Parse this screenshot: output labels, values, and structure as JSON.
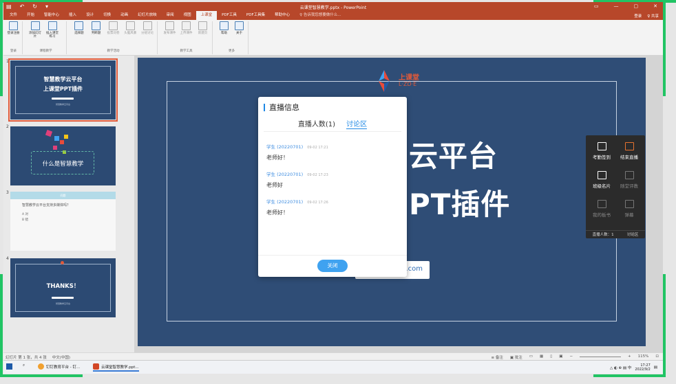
{
  "titlebar": {
    "doc_title": "云课堂智慧教学.pptx - PowerPoint",
    "qat": [
      "▤",
      "↶",
      "↻",
      "▾"
    ],
    "win_controls": [
      "▭",
      "—",
      "▢",
      "✕"
    ]
  },
  "menubar": {
    "tabs": [
      "文件",
      "开始",
      "智能中心",
      "插入",
      "设计",
      "切换",
      "动画",
      "幻灯片放映",
      "审阅",
      "视图",
      "上课堂",
      "PDF工具",
      "PDF工具集",
      "帮助中心"
    ],
    "active_tab": "上课堂",
    "search_hint": "♀ 告诉我您想要做什么...",
    "account": [
      "登录",
      "♀ 共享"
    ]
  },
  "ribbon": {
    "groups": [
      {
        "label": "登录",
        "buttons": [
          "登录注册"
        ]
      },
      {
        "label": "课程教学",
        "buttons": [
          "添加幻灯片",
          "插入课堂练习"
        ]
      },
      {
        "label": "教学活动",
        "buttons": [
          "选择题",
          "判断题",
          "投票问卷",
          "头脑风暴",
          "分组讨论"
        ]
      },
      {
        "label": "教学工具",
        "buttons": [
          "发布课件",
          "上传课件",
          "新建页"
        ]
      },
      {
        "label": "更多",
        "buttons": [
          "帮助",
          "关于"
        ]
      }
    ]
  },
  "thumbnails": [
    {
      "num": "1",
      "line1": "智慧教学云平台",
      "line2": "上课堂PPT插件",
      "caption": "智慧教学云平台"
    },
    {
      "num": "2",
      "line1": "什么是智慧教学"
    },
    {
      "num": "3",
      "header": "问题",
      "question": "智慧教学云平台支持多媒体吗？",
      "opt_a": "A  对",
      "opt_b": "B  错"
    },
    {
      "num": "4",
      "line1": "THANKS！",
      "caption": "智慧教学云平台"
    }
  ],
  "slide": {
    "logo_name": "上课堂",
    "logo_sub": "L·ZD·E",
    "title_line1": "云平台",
    "title_line2": "PT插件",
    "url_text": ".com"
  },
  "live_dialog": {
    "title": "直播信息",
    "tab_viewers": "直播人数(1)",
    "tab_discussion": "讨论区",
    "messages": [
      {
        "user": "学生 (20220701)",
        "time": "09-02 17:21",
        "text": "老师好！"
      },
      {
        "user": "学生 (20220701)",
        "time": "09-02 17:23",
        "text": "老师好"
      },
      {
        "user": "学生 (20220701)",
        "time": "09-02 17:26",
        "text": "老师好！"
      }
    ],
    "close_label": "关闭"
  },
  "side_panel": {
    "items": [
      {
        "label": "考勤签到",
        "icon": "calendar-icon"
      },
      {
        "label": "结束直播",
        "icon": "tv-icon"
      },
      {
        "label": "班级名片",
        "icon": "card-icon"
      },
      {
        "label": "随堂评教",
        "icon": "edit-icon"
      },
      {
        "label": "我的板书",
        "icon": "board-icon"
      },
      {
        "label": "弹幕",
        "icon": "danmaku-icon"
      }
    ],
    "bottom_left": "直播人数：1",
    "bottom_right": "讨论区"
  },
  "statusbar": {
    "slide_info": "幻灯片 第 1 张，共 4 张",
    "language": "中文(中国)",
    "notes": "≡ 备注",
    "comments": "▣ 批注",
    "zoom": "115%"
  },
  "taskbar": {
    "items": [
      "钉钉教育平台 - 钉...",
      "云课堂智慧教学.ppt..."
    ],
    "tray": "△ ◐ ⊕ ▤ 中",
    "time": "17:27",
    "date": "2022/9/2"
  },
  "colors": {
    "ppt_red": "#b7472a",
    "slide_blue": "#2f4d76",
    "accent_blue": "#1e88e5",
    "frame_green": "#21c464"
  }
}
